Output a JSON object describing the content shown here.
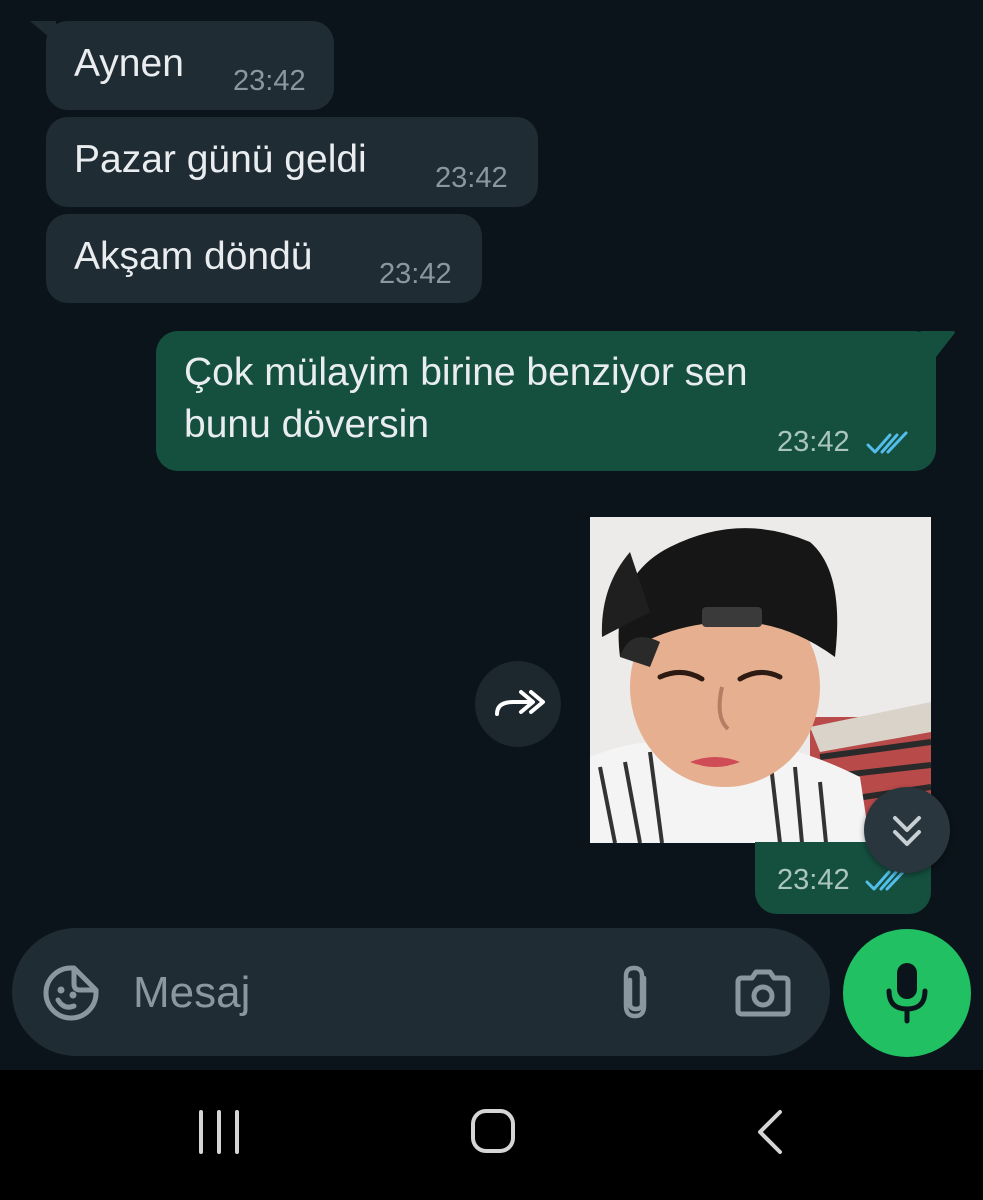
{
  "messages": [
    {
      "direction": "incoming",
      "text": "Aynen",
      "time": "23:42"
    },
    {
      "direction": "incoming",
      "text": "Pazar günü geldi",
      "time": "23:42"
    },
    {
      "direction": "incoming",
      "text": "Akşam döndü",
      "time": "23:42"
    },
    {
      "direction": "outgoing",
      "lines": [
        "Çok mülayim birine benziyor sen",
        "bunu döversin"
      ],
      "time": "23:42",
      "status": "read"
    },
    {
      "direction": "outgoing",
      "type": "image",
      "image_content": "photo of a person wearing a backwards black cap and a striped shirt",
      "time": "23:42",
      "status": "read"
    }
  ],
  "composer": {
    "placeholder": "Mesaj"
  },
  "icons": {
    "forward": "forward-icon",
    "scroll_down": "double-chevron-down-icon",
    "sticker": "sticker-icon",
    "attach": "paperclip-icon",
    "camera": "camera-icon",
    "mic": "microphone-icon",
    "read_ticks": "double-check-icon",
    "nav_recents": "recent-apps-icon",
    "nav_home": "home-icon",
    "nav_back": "back-icon"
  },
  "colors": {
    "background": "#0b141a",
    "incoming_bubble": "#202c33",
    "outgoing_bubble": "#15503f",
    "read_ticks": "#53bdeb",
    "mic_button": "#21c063"
  }
}
